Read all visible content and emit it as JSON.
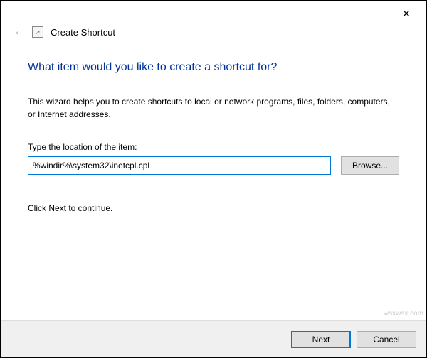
{
  "window": {
    "close_icon": "✕"
  },
  "header": {
    "back_icon": "←",
    "shortcut_icon_glyph": "↗",
    "title": "Create Shortcut"
  },
  "main": {
    "heading": "What item would you like to create a shortcut for?",
    "description": "This wizard helps you to create shortcuts to local or network programs, files, folders, computers, or Internet addresses.",
    "field_label": "Type the location of the item:",
    "location_value": "%windir%\\system32\\inetcpl.cpl",
    "browse_label": "Browse...",
    "continue_text": "Click Next to continue."
  },
  "footer": {
    "next_label": "Next",
    "cancel_label": "Cancel"
  },
  "watermark": "wsxwsx.com"
}
